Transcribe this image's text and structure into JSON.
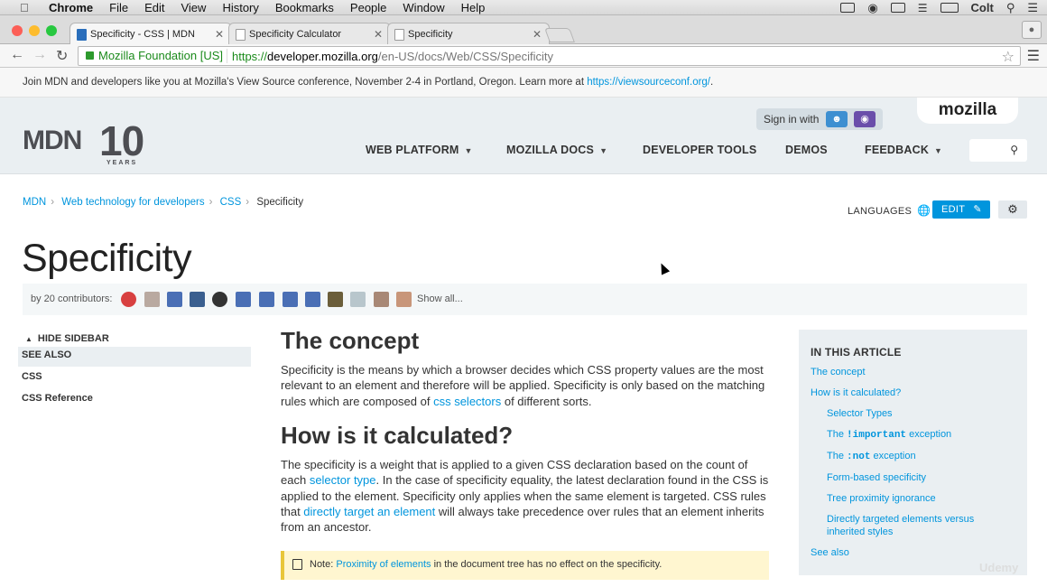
{
  "menubar": {
    "app": "Chrome",
    "items": [
      "File",
      "Edit",
      "View",
      "History",
      "Bookmarks",
      "People",
      "Window",
      "Help"
    ],
    "user": "Colt"
  },
  "tabs": [
    {
      "title": "Specificity - CSS | MDN"
    },
    {
      "title": "Specificity Calculator"
    },
    {
      "title": "Specificity"
    }
  ],
  "omnibox": {
    "ev_label": "Mozilla Foundation [US]",
    "scheme": "https://",
    "host": "developer.mozilla.org",
    "path": "/en-US/docs/Web/CSS/Specificity"
  },
  "banner": {
    "text": "Join MDN and developers like you at Mozilla's View Source conference, November 2-4 in Portland, Oregon. Learn more at ",
    "link": "https://viewsourceconf.org/",
    "end": "."
  },
  "header": {
    "logo_mdn": "MDN",
    "logo_ten": "10",
    "logo_years": "YEARS",
    "signin_label": "Sign in with",
    "mozilla": "mozilla",
    "nav": [
      "WEB PLATFORM",
      "MOZILLA DOCS",
      "DEVELOPER TOOLS",
      "DEMOS",
      "FEEDBACK"
    ]
  },
  "breadcrumb": {
    "items": [
      "MDN",
      "Web technology for developers",
      "CSS"
    ],
    "current": "Specificity"
  },
  "languages_label": "LANGUAGES",
  "edit_label": "EDIT",
  "page_title": "Specificity",
  "contributors": {
    "label": "by 20 contributors:",
    "show_all": "Show all..."
  },
  "sidebar": {
    "hide_label": "HIDE SIDEBAR",
    "items": [
      "SEE ALSO",
      "CSS",
      "CSS Reference"
    ]
  },
  "article": {
    "h_concept": "The concept",
    "p_concept_1": "Specificity is the means by which a browser decides which CSS property values are the most relevant to an element and therefore will be applied. Specificity is only based on the matching rules which are composed of ",
    "p_concept_link": "css selectors",
    "p_concept_2": " of different sorts.",
    "h_calc": "How is it calculated?",
    "p_calc_1": "The specificity is a weight that is applied to a given CSS declaration based on the count of each ",
    "p_calc_link1": "selector type",
    "p_calc_2": ". In the case of specificity equality, the latest declaration found in the CSS is applied to the element. Specificity only applies when the same element is targeted. CSS rules that ",
    "p_calc_link2": "directly target an element",
    "p_calc_3": " will always take precedence over rules that an element inherits from an ancestor.",
    "note_label": "Note: ",
    "note_link": "Proximity of elements",
    "note_text": " in the document tree has no effect on the specificity."
  },
  "toc": {
    "heading": "IN THIS ARTICLE",
    "concept": "The concept",
    "calc": "How is it calculated?",
    "selector_types": "Selector Types",
    "important_pre": "The ",
    "important_code": "!important",
    "important_post": " exception",
    "not_pre": "The ",
    "not_code": ":not",
    "not_post": " exception",
    "form_based": "Form-based specificity",
    "tree": "Tree proximity ignorance",
    "direct": "Directly targeted elements versus inherited styles",
    "see_also": "See also"
  },
  "watermark": "Udemy",
  "colors": {
    "link": "#0095dd",
    "edit_bg": "#0095dd",
    "header_bg": "#eaeff2"
  }
}
